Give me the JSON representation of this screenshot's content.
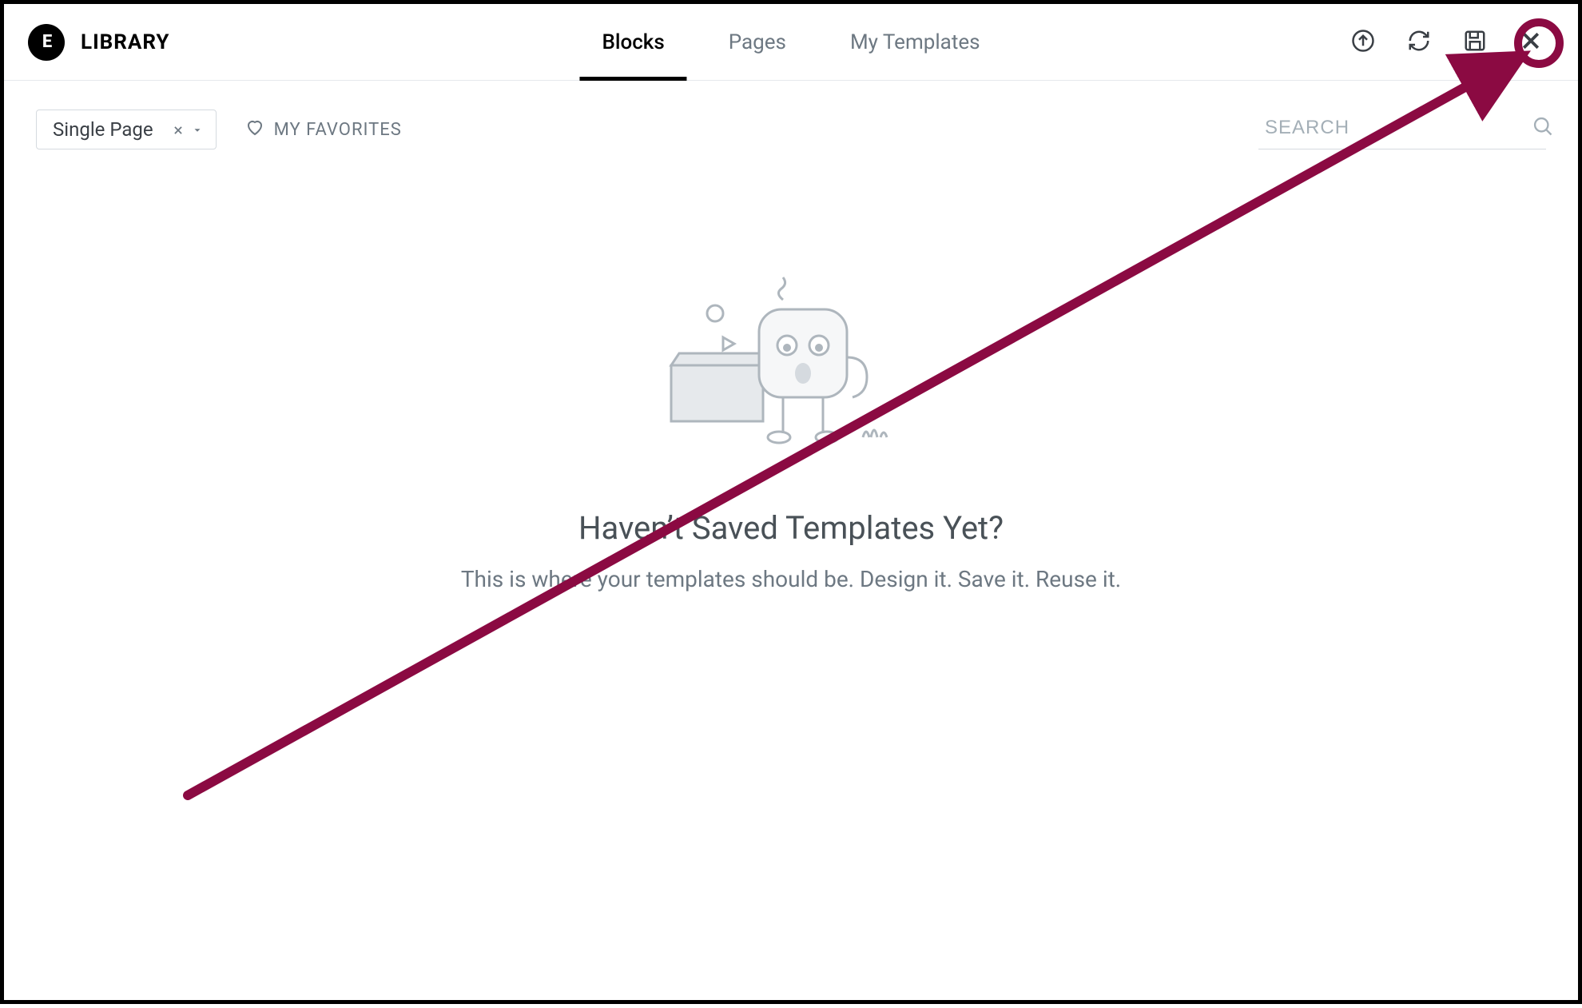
{
  "header": {
    "brand_logo_text": "E",
    "brand_title": "LIBRARY",
    "tabs": [
      {
        "label": "Blocks",
        "active": true
      },
      {
        "label": "Pages",
        "active": false
      },
      {
        "label": "My Templates",
        "active": false
      }
    ],
    "actions": {
      "upload": "upload",
      "sync": "sync",
      "save": "save",
      "close": "close"
    }
  },
  "toolbar": {
    "filter_chip_label": "Single Page",
    "favorites_label": "MY FAVORITES",
    "search_placeholder": "SEARCH"
  },
  "empty_state": {
    "title": "Haven’t Saved Templates Yet?",
    "subtitle": "This is where your templates should be. Design it. Save it. Reuse it."
  },
  "annotation": {
    "color": "#8b0a42",
    "target": "close-button"
  }
}
